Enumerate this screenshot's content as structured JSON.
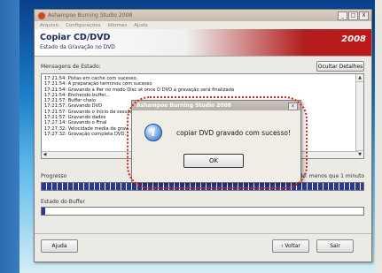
{
  "window": {
    "app_title": "Ashampoo Burning Studio 2008",
    "controls": [
      "_",
      "□",
      "X"
    ]
  },
  "menu": [
    "Arquivo",
    "Configurações",
    "Idiomas",
    "Ajuda"
  ],
  "header": {
    "title": "Copiar CD/DVD",
    "subtitle": "Estado da Gravação no DVD",
    "year": "2008"
  },
  "status": {
    "label": "Mensagens de Estado:",
    "hide_details_button": "Ocultar Detalhes"
  },
  "log_lines": [
    "17:21:54: Pistas em cache com sucesso",
    "17:21:54: A preparação terminou com sucesso",
    "17:21:54: Gravando a Ifer no modo Disc at once O DVD a gravação será finalizada",
    "17:21:54: Enchendo buffer...",
    "17:21:57: Buffer cheio",
    "17:21:57: Gravando DVD",
    "17:21:57: Gravando o início da sessão",
    "17:21:57: Gravando dados",
    "17:27:14: Gravando o Final",
    "17:27:32: Velocidade media de grav...",
    "17:27:32: Gravação completa DVD..."
  ],
  "progress": {
    "label": "Progresso",
    "time_remaining": "ndo: menos que 1 minuto",
    "fraction": 1.0
  },
  "buffer": {
    "label": "Estado do Buffer",
    "fraction": 0.01
  },
  "footer": {
    "help_button": "Ajuda",
    "back_button": "‹ Voltar",
    "exit_button": "Sair"
  },
  "dialog": {
    "title": "Ashampoo Burning Studio 2008",
    "message": "copiar DVD gravado com sucesso!",
    "ok_button": "OK",
    "icon": "info-icon"
  },
  "colors": {
    "progress": "#283a92",
    "highlight": "#d8231b",
    "header_red": "#b21e1e"
  }
}
